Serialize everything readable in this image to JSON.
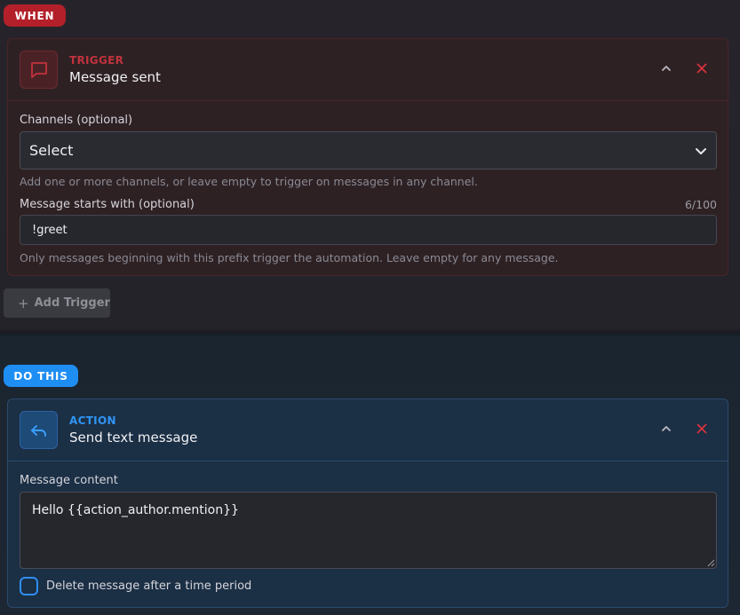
{
  "when_section": {
    "badge": "WHEN",
    "trigger_card": {
      "kicker": "TRIGGER",
      "title": "Message sent",
      "icon": "message-icon",
      "channels": {
        "label": "Channels (optional)",
        "value": "Select",
        "help": "Add one or more channels, or leave empty to trigger on messages in any channel."
      },
      "prefix": {
        "label": "Message starts with (optional)",
        "counter": "6/100",
        "value": "!greet",
        "help": "Only messages beginning with this prefix trigger the automation. Leave empty for any message."
      }
    },
    "add_trigger": {
      "plus": "+",
      "label": "Add Trigger"
    }
  },
  "do_section": {
    "badge": "DO THIS",
    "action_card": {
      "kicker": "ACTION",
      "title": "Send text message",
      "icon": "reply-icon",
      "message_content": {
        "label": "Message content",
        "value": "Hello {{action_author.mention}}"
      },
      "delete_after": {
        "label": "Delete message after a time period",
        "checked": false
      }
    }
  },
  "colors": {
    "when_accent": "#b3202a",
    "do_accent": "#1f8ef2",
    "close_red": "#d8323c"
  }
}
